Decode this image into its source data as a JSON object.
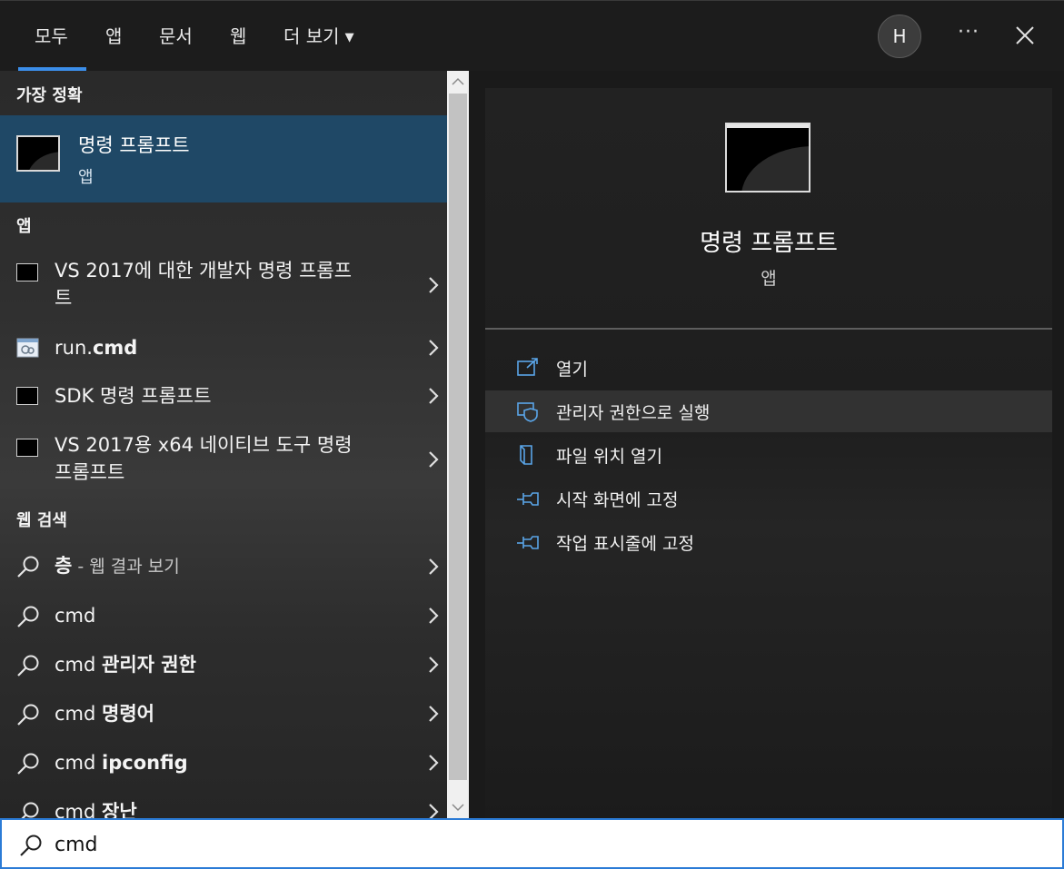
{
  "tabs": [
    {
      "label": "모두",
      "active": true
    },
    {
      "label": "앱"
    },
    {
      "label": "문서"
    },
    {
      "label": "웹"
    },
    {
      "label": "더 보기"
    }
  ],
  "header": {
    "avatar_letter": "H",
    "more_label": "···"
  },
  "left": {
    "best_match_heading": "가장 정확",
    "best_match": {
      "title": "명령 프롬프트",
      "subtitle": "앱",
      "icon": "cmd-icon"
    },
    "apps_heading": "앱",
    "apps": [
      {
        "line1": "VS 2017에 대한 개발자 명령 프롬프",
        "line2": "트",
        "icon": "cmd-icon"
      },
      {
        "prefix": "run.",
        "bold": "cmd",
        "icon": "batch-file-icon"
      },
      {
        "text": "SDK 명령 프롬프트",
        "icon": "cmd-icon"
      },
      {
        "line1": "VS 2017용 x64 네이티브 도구 명령",
        "line2": "프롬프트",
        "icon": "cmd-icon"
      }
    ],
    "web_heading": "웹 검색",
    "web": [
      {
        "bold": "층",
        "suffix": " - 웹 결과 보기"
      },
      {
        "prefix": "cmd"
      },
      {
        "prefix": "cmd ",
        "bold": "관리자 권한"
      },
      {
        "prefix": "cmd ",
        "bold": "명령어"
      },
      {
        "prefix": "cmd ",
        "bold": "ipconfig"
      },
      {
        "prefix": "cmd ",
        "bold": "장난"
      }
    ]
  },
  "detail": {
    "title": "명령 프롬프트",
    "subtitle": "앱",
    "actions": [
      {
        "label": "열기",
        "icon": "open-icon"
      },
      {
        "label": "관리자 권한으로 실행",
        "icon": "shield-icon",
        "hover": true
      },
      {
        "label": "파일 위치 열기",
        "icon": "file-location-icon"
      },
      {
        "label": "시작 화면에 고정",
        "icon": "pin-icon"
      },
      {
        "label": "작업 표시줄에 고정",
        "icon": "pin-icon"
      }
    ]
  },
  "search": {
    "value": "cmd"
  },
  "colors": {
    "accent": "#3b8eea",
    "selected_row": "#1f4866",
    "action_icon": "#5aa5e8"
  }
}
